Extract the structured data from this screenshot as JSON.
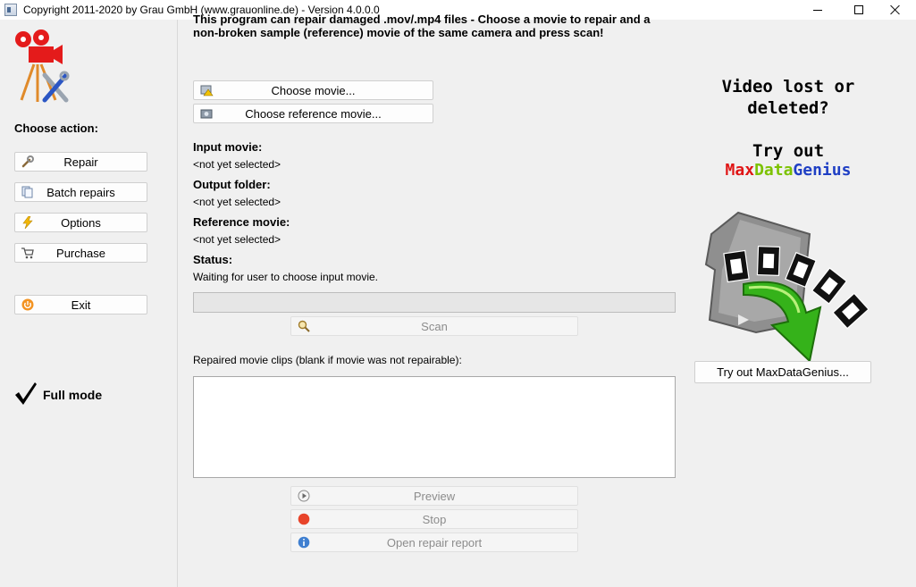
{
  "window": {
    "title": "Copyright 2011-2020 by Grau GmbH (www.grauonline.de) - Version 4.0.0.0"
  },
  "sidebar": {
    "heading": "Choose action:",
    "buttons": [
      {
        "label": "Repair",
        "icon": "wrench-icon"
      },
      {
        "label": "Batch repairs",
        "icon": "documents-icon"
      },
      {
        "label": "Options",
        "icon": "lightning-icon"
      },
      {
        "label": "Purchase",
        "icon": "cart-icon"
      },
      {
        "label": "Exit",
        "icon": "power-icon"
      }
    ],
    "mode_label": "Full mode"
  },
  "main": {
    "intro": "This program can repair damaged .mov/.mp4 files - Choose a movie to repair and a non-broken sample (reference) movie of the same camera and press scan!",
    "choose_movie_label": "Choose movie...",
    "choose_reference_label": "Choose reference movie...",
    "fields": [
      {
        "label": "Input movie:",
        "value": "<not yet selected>"
      },
      {
        "label": "Output folder:",
        "value": "<not yet selected>"
      },
      {
        "label": "Reference movie:",
        "value": "<not yet selected>"
      },
      {
        "label": "Status:",
        "value": "Waiting for user to choose input movie."
      }
    ],
    "progress_fraction": 0,
    "scan_label": "Scan",
    "clips_label": "Repaired movie clips (blank if movie was not repairable):",
    "preview_label": "Preview",
    "stop_label": "Stop",
    "report_label": "Open repair report"
  },
  "ad": {
    "line1": "Video lost or",
    "line2": "deleted?",
    "line3": "Try out",
    "brand_part1": "Max",
    "brand_part2": "Data",
    "brand_part3": "Genius",
    "button_label": "Try out MaxDataGenius..."
  },
  "colors": {
    "brand_red": "#e01515",
    "brand_green": "#7cc200",
    "brand_blue": "#1f3fc4"
  }
}
